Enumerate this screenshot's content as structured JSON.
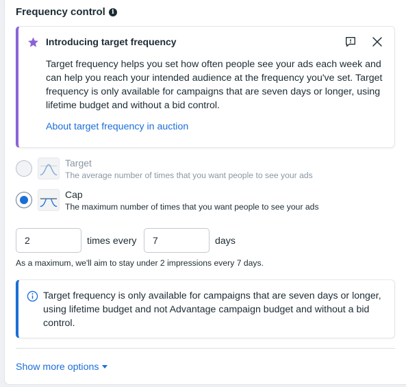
{
  "section": {
    "title": "Frequency control",
    "info_icon": "info-icon"
  },
  "intro": {
    "icon": "star-icon",
    "title": "Introducing target frequency",
    "feedback_icon": "feedback-icon",
    "close_icon": "close-icon",
    "body": "Target frequency helps you set how often people see your ads each week and can help you reach your intended audience at the frequency you've set. Target frequency is only available for campaigns that are seven days or longer, using lifetime budget and without a bid control.",
    "link": "About target frequency in auction",
    "accent_color": "#8b63d8"
  },
  "options": [
    {
      "label": "Target",
      "description": "The average number of times that you want people to see your ads",
      "selected": false,
      "disabled": true,
      "icon": "bell-curve-icon"
    },
    {
      "label": "Cap",
      "description": "The maximum number of times that you want people to see your ads",
      "selected": true,
      "disabled": false,
      "icon": "capped-curve-icon"
    }
  ],
  "frequency": {
    "times_value": "2",
    "times_every_label": "times every",
    "days_value": "7",
    "days_label": "days",
    "summary": "As a maximum, we'll aim to stay under 2 impressions every 7 days."
  },
  "notice": {
    "icon": "info-circle-icon",
    "text": "Target frequency is only available for campaigns that are seven days or longer, using lifetime budget and not Advantage campaign budget and without a bid control.",
    "accent_color": "#1a6ed8"
  },
  "footer": {
    "show_more": "Show more options",
    "caret_icon": "caret-down-icon"
  },
  "colors": {
    "link": "#1a6ed8",
    "text": "#1c2b33",
    "muted": "#8a96a3"
  }
}
